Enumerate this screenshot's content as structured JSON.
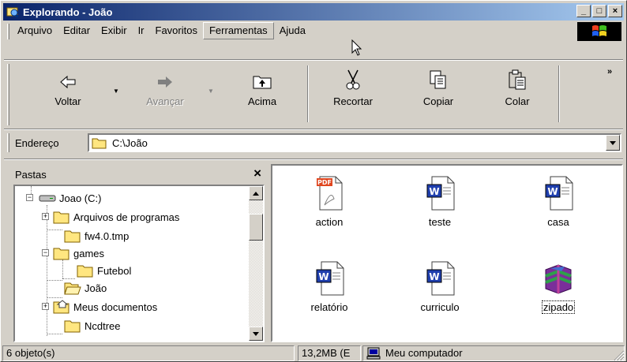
{
  "window": {
    "title": "Explorando - João",
    "controls": {
      "minimize": "_",
      "maximize": "□",
      "close": "×"
    }
  },
  "menu": {
    "items": [
      {
        "label": "Arquivo",
        "access_key": "A"
      },
      {
        "label": "Editar",
        "access_key": "E"
      },
      {
        "label": "Exibir",
        "access_key": "x"
      },
      {
        "label": "Ir",
        "access_key": "I"
      },
      {
        "label": "Favoritos",
        "access_key": "F"
      },
      {
        "label": "Ferramentas",
        "access_key": "a",
        "highlighted": true
      },
      {
        "label": "Ajuda",
        "access_key": "j"
      }
    ]
  },
  "toolbar": {
    "back_label": "Voltar",
    "forward_label": "Avançar",
    "up_label": "Acima",
    "cut_label": "Recortar",
    "copy_label": "Copiar",
    "paste_label": "Colar",
    "more": "»"
  },
  "address": {
    "label": "Endereço",
    "value": "C:\\João"
  },
  "folders": {
    "title": "Pastas",
    "close": "×",
    "tree": [
      {
        "label": "Joao (C:)",
        "icon": "drive-icon",
        "expander": "−"
      },
      {
        "label": "Arquivos de programas",
        "icon": "folder-icon",
        "expander": "+"
      },
      {
        "label": "fw4.0.tmp",
        "icon": "folder-icon",
        "expander": ""
      },
      {
        "label": "games",
        "icon": "folder-icon",
        "expander": "−"
      },
      {
        "label": "Futebol",
        "icon": "folder-icon",
        "expander": ""
      },
      {
        "label": "João",
        "icon": "folder-open-icon",
        "expander": ""
      },
      {
        "label": "Meus documentos",
        "icon": "my-documents-icon",
        "expander": "+"
      },
      {
        "label": "Ncdtree",
        "icon": "folder-icon",
        "expander": ""
      }
    ]
  },
  "files": [
    {
      "name": "action",
      "icon": "pdf-file-icon",
      "badge": "PDF"
    },
    {
      "name": "teste",
      "icon": "word-file-icon",
      "badge": "W"
    },
    {
      "name": "casa",
      "icon": "word-file-icon",
      "badge": "W"
    },
    {
      "name": "relatório",
      "icon": "word-file-icon",
      "badge": "W"
    },
    {
      "name": "curriculo",
      "icon": "word-file-icon",
      "badge": "W"
    },
    {
      "name": "zipado",
      "icon": "winrar-archive-icon",
      "focused": true
    }
  ],
  "status": {
    "objects": "6 objeto(s)",
    "size": "13,2MB (E",
    "location": "Meu computador"
  },
  "colors": {
    "face": "#d4d0c8",
    "title_start": "#0a246a",
    "title_end": "#a6caf0",
    "folder_yellow": "#ffe680",
    "word_blue": "#1f3fae",
    "pdf_red": "#e0461f"
  }
}
